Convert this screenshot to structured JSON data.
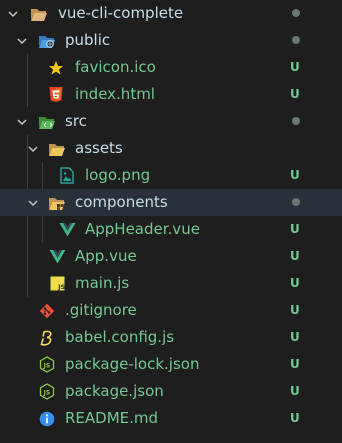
{
  "explorer": {
    "root": {
      "label": "vue-cli-complete"
    },
    "public": {
      "label": "public",
      "children": [
        {
          "label": "favicon.ico",
          "status": "U",
          "icon": "star-icon"
        },
        {
          "label": "index.html",
          "status": "U",
          "icon": "html5-icon"
        }
      ]
    },
    "src": {
      "label": "src",
      "assets": {
        "label": "assets",
        "children": [
          {
            "label": "logo.png",
            "status": "U",
            "icon": "image-icon"
          }
        ]
      },
      "components": {
        "label": "components",
        "children": [
          {
            "label": "AppHeader.vue",
            "status": "U",
            "icon": "vue-icon"
          }
        ]
      },
      "files": [
        {
          "label": "App.vue",
          "status": "U",
          "icon": "vue-icon"
        },
        {
          "label": "main.js",
          "status": "U",
          "icon": "js-icon"
        }
      ]
    },
    "root_files": [
      {
        "label": ".gitignore",
        "status": "U",
        "icon": "git-icon"
      },
      {
        "label": "babel.config.js",
        "status": "U",
        "icon": "babel-icon"
      },
      {
        "label": "package-lock.json",
        "status": "U",
        "icon": "nodejs-icon"
      },
      {
        "label": "package.json",
        "status": "U",
        "icon": "nodejs-icon"
      },
      {
        "label": "README.md",
        "status": "U",
        "icon": "info-icon"
      }
    ]
  },
  "colors": {
    "background": "#1e1e1e",
    "selection": "#293139",
    "untracked": "#73c991",
    "folder": "#dcb67a",
    "vue": "#41b883",
    "html": "#e44d26",
    "js": "#f0db4f",
    "info": "#3b8eea",
    "git": "#f05032"
  }
}
